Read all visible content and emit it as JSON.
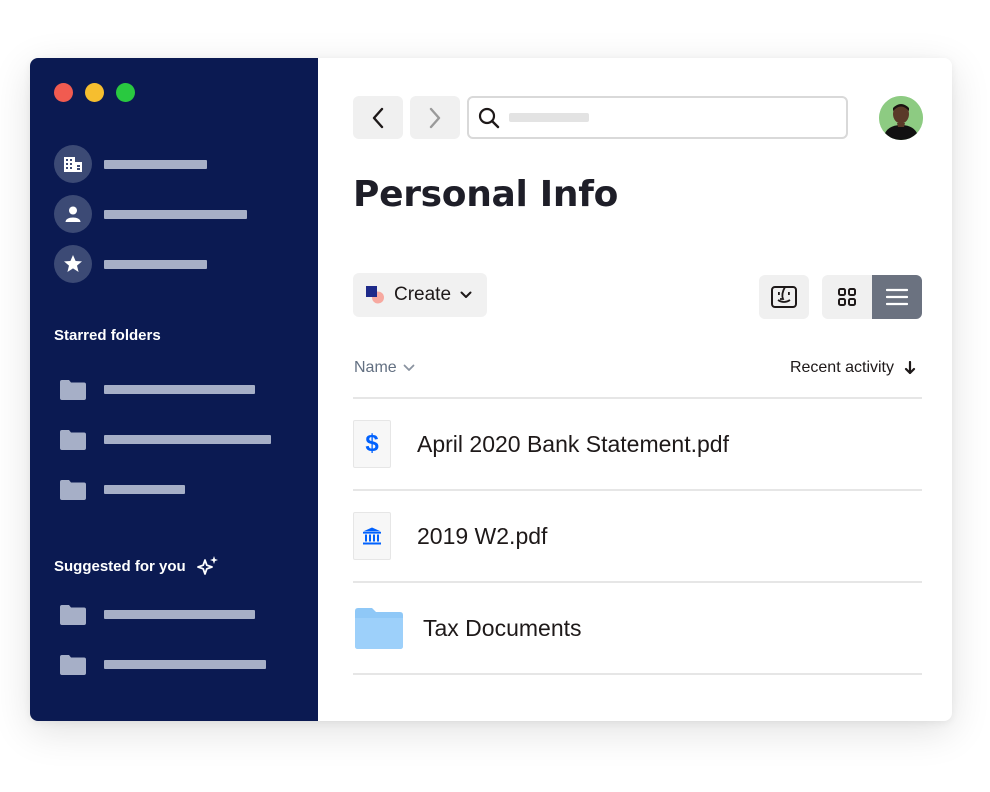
{
  "sidebar": {
    "nav_items": [
      {
        "icon": "building-icon"
      },
      {
        "icon": "person-icon"
      },
      {
        "icon": "star-icon"
      }
    ],
    "starred_title": "Starred folders",
    "suggested_title": "Suggested for you"
  },
  "header": {
    "search_value": "",
    "page_title": "Personal Info"
  },
  "toolbar": {
    "create_label": "Create"
  },
  "table": {
    "columns": {
      "name": "Name",
      "recent": "Recent activity"
    },
    "rows": [
      {
        "name": "April 2020 Bank Statement.pdf",
        "icon": "dollar-icon"
      },
      {
        "name": "2019 W2.pdf",
        "icon": "bank-icon"
      },
      {
        "name": "Tax Documents",
        "icon": "folder-icon"
      }
    ]
  },
  "colors": {
    "sidebar_bg": "#0b1a52",
    "accent_blue": "#0061fe",
    "folder_blue": "#8fc8f7"
  }
}
